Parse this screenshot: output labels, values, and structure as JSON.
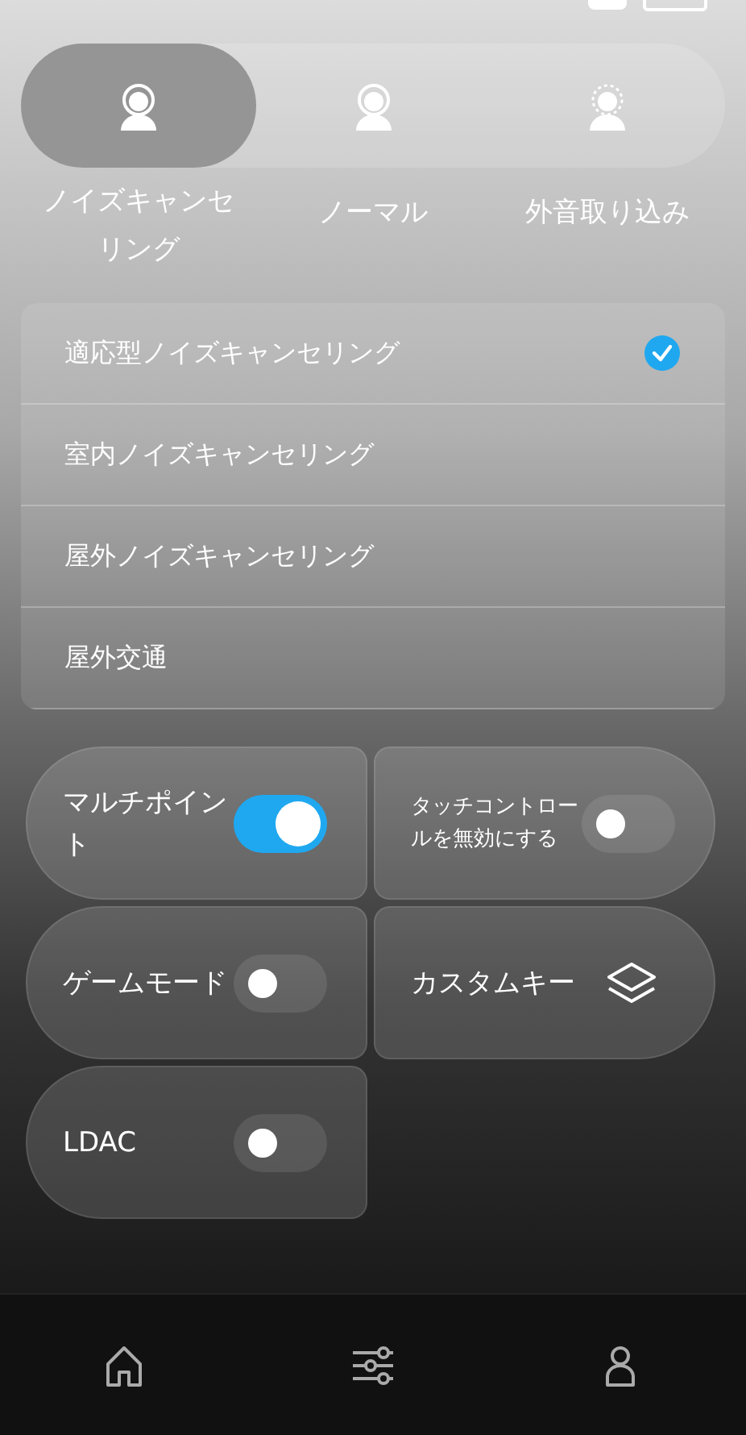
{
  "modes": [
    {
      "label": "ノイズキャンセリング",
      "kind": "anc",
      "selected": true
    },
    {
      "label": "ノーマル",
      "kind": "normal",
      "selected": false
    },
    {
      "label": "外音取り込み",
      "kind": "ambient",
      "selected": false
    }
  ],
  "anc_options": [
    {
      "label": "適応型ノイズキャンセリング",
      "selected": true
    },
    {
      "label": "室内ノイズキャンセリング",
      "selected": false
    },
    {
      "label": "屋外ノイズキャンセリング",
      "selected": false
    },
    {
      "label": "屋外交通",
      "selected": false
    }
  ],
  "tiles": [
    {
      "label": "マルチポイント",
      "kind": "toggle",
      "on": true
    },
    {
      "label": "タッチコントロールを無効にする",
      "kind": "toggle",
      "on": false
    },
    {
      "label": "ゲームモード",
      "kind": "toggle",
      "on": false
    },
    {
      "label": "カスタムキー",
      "kind": "button"
    },
    {
      "label": "LDAC",
      "kind": "toggle",
      "on": false
    }
  ],
  "bottom_nav": [
    {
      "kind": "home"
    },
    {
      "kind": "equalizer"
    },
    {
      "kind": "profile"
    }
  ]
}
